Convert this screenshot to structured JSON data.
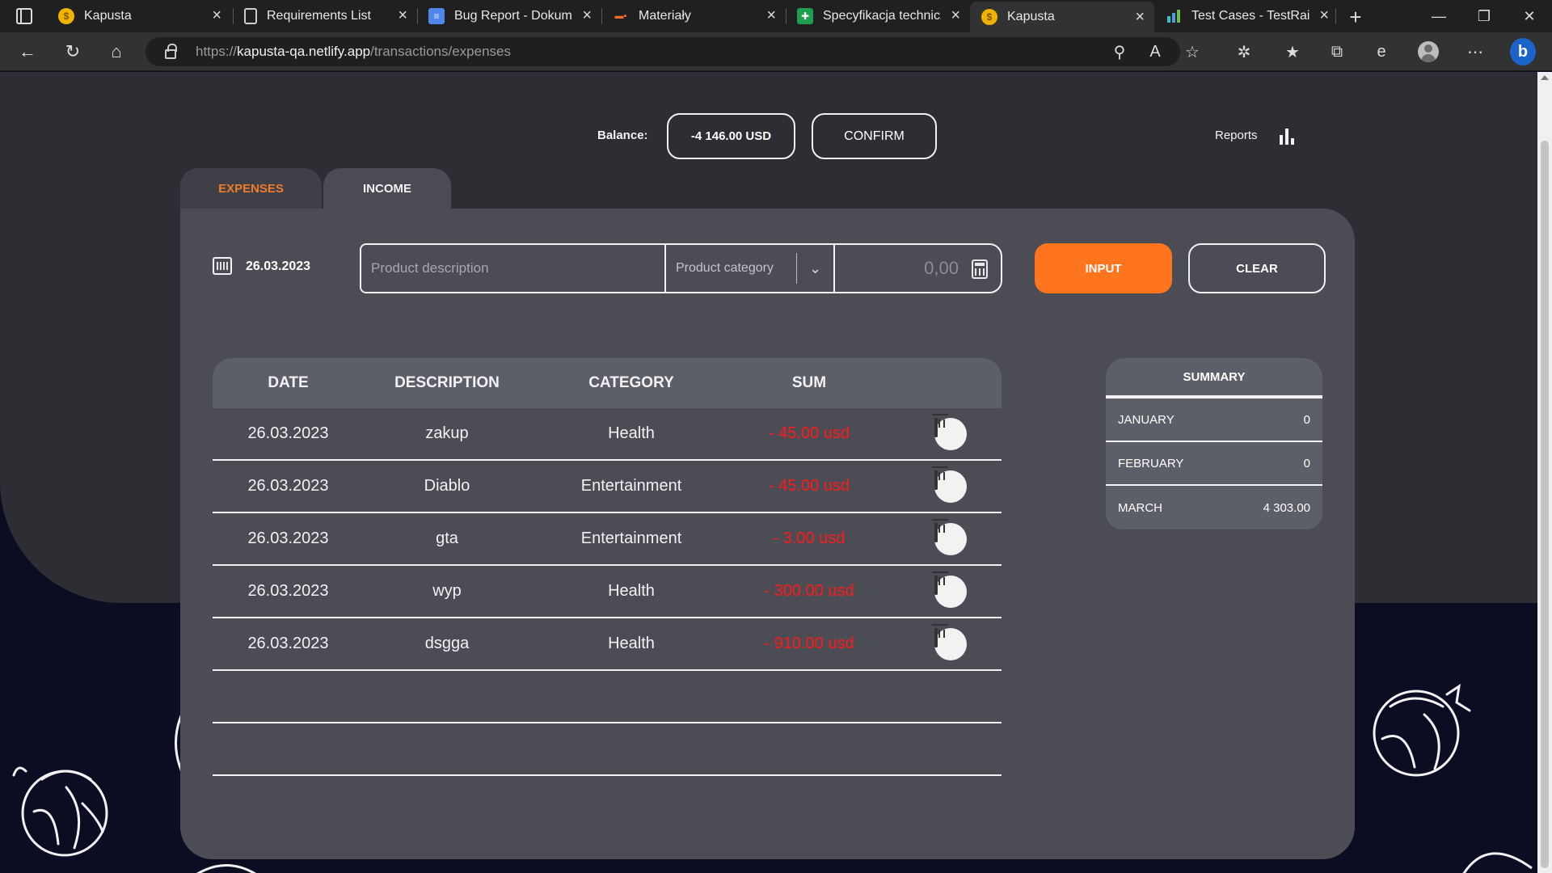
{
  "browser": {
    "tabs": [
      {
        "title": "Kapusta",
        "favicon": "coin-icon",
        "active": false
      },
      {
        "title": "Requirements List",
        "favicon": "document-icon",
        "active": false
      },
      {
        "title": "Bug Report - Dokumen",
        "favicon": "google-docs-icon",
        "active": false
      },
      {
        "title": "Materiały",
        "favicon": "materials-icon",
        "active": false
      },
      {
        "title": "Specyfikacja techniczn",
        "favicon": "google-sheets-icon",
        "active": false
      },
      {
        "title": "Kapusta",
        "favicon": "coin-icon",
        "active": true
      },
      {
        "title": "Test Cases - TestRail",
        "favicon": "testrail-icon",
        "active": false
      }
    ],
    "url_prefix": "https://",
    "url_host": "kapusta-qa.netlify.app",
    "url_path": "/transactions/expenses"
  },
  "header": {
    "balance_label": "Balance:",
    "balance_value": "-4 146.00 USD",
    "confirm_label": "CONFIRM",
    "reports_label": "Reports"
  },
  "tabs": {
    "expenses": "EXPENSES",
    "income": "INCOME"
  },
  "form": {
    "date": "26.03.2023",
    "description_placeholder": "Product description",
    "category_placeholder": "Product category",
    "sum_placeholder": "0,00",
    "input_label": "INPUT",
    "clear_label": "CLEAR"
  },
  "table": {
    "headers": [
      "DATE",
      "DESCRIPTION",
      "CATEGORY",
      "SUM"
    ],
    "rows": [
      {
        "date": "26.03.2023",
        "description": "zakup",
        "category": "Health",
        "sum": "- 45.00 usd"
      },
      {
        "date": "26.03.2023",
        "description": "Diablo",
        "category": "Entertainment",
        "sum": "- 45.00 usd"
      },
      {
        "date": "26.03.2023",
        "description": "gta",
        "category": "Entertainment",
        "sum": "- 3.00 usd"
      },
      {
        "date": "26.03.2023",
        "description": "wyp",
        "category": "Health",
        "sum": "- 300.00 usd"
      },
      {
        "date": "26.03.2023",
        "description": "dsgga",
        "category": "Health",
        "sum": "- 910.00 usd"
      }
    ]
  },
  "summary": {
    "title": "SUMMARY",
    "months": [
      {
        "month": "JANUARY",
        "value": "0"
      },
      {
        "month": "FEBRUARY",
        "value": "0"
      },
      {
        "month": "MARCH",
        "value": "4 303.00"
      }
    ]
  },
  "colors": {
    "accent": "#ff751d",
    "expense_red": "#ff1a1a",
    "panel": "#4b4c54",
    "background_dark": "#0c0c22"
  }
}
